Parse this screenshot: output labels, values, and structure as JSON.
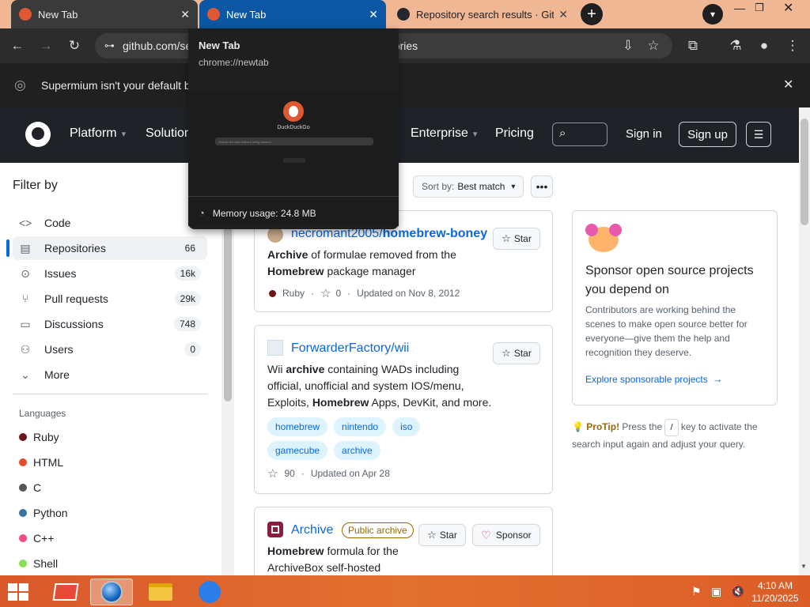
{
  "browser": {
    "tabs": [
      {
        "title": "New Tab"
      },
      {
        "title": "New Tab"
      },
      {
        "title": "Repository search results · GitHub"
      }
    ],
    "address": "github.com/search?q=homebrew+archive&type=repositories",
    "infobar_text": "Supermium isn't your default browser"
  },
  "hover_card": {
    "title": "New Tab",
    "url": "chrome://newtab",
    "preview_brand": "DuckDuckGo",
    "preview_search_placeholder": "Search the web without being tracked",
    "memory": "Memory usage: 24.8 MB"
  },
  "gh": {
    "nav": [
      "Platform",
      "Solutions",
      "Enterprise",
      "Pricing"
    ],
    "sign_in": "Sign in",
    "sign_up": "Sign up"
  },
  "sidebar": {
    "heading": "Filter by",
    "items": [
      {
        "label": "Code",
        "count": ""
      },
      {
        "label": "Repositories",
        "count": "66"
      },
      {
        "label": "Issues",
        "count": "16k"
      },
      {
        "label": "Pull requests",
        "count": "29k"
      },
      {
        "label": "Discussions",
        "count": "748"
      },
      {
        "label": "Users",
        "count": "0"
      },
      {
        "label": "More",
        "count": ""
      }
    ],
    "languages_heading": "Languages",
    "languages": [
      {
        "name": "Ruby",
        "color": "#701516"
      },
      {
        "name": "HTML",
        "color": "#e34c26"
      },
      {
        "name": "C",
        "color": "#555555"
      },
      {
        "name": "Python",
        "color": "#3572A5"
      },
      {
        "name": "C++",
        "color": "#f34b7d"
      },
      {
        "name": "Shell",
        "color": "#89e051"
      }
    ]
  },
  "results": {
    "sort_label": "Sort by:",
    "sort_value": "Best match",
    "star_label": "Star",
    "sponsor_label": "Sponsor",
    "repo1": {
      "name_owner": "necromant2005/",
      "name_repo": "homebrew-boney",
      "desc_bold": "Archive",
      "desc_rest": " of formulae removed from the",
      "desc_bold2": "Homebrew",
      "desc_rest2": " package manager",
      "language": "Ruby",
      "stars": "0",
      "updated": "Updated on Nov 8, 2012"
    },
    "repo2": {
      "name": "ForwarderFactory/wii",
      "desc_a": "Wii ",
      "desc_b": "archive",
      "desc_c": " containing WADs including",
      "desc_line2": "official, unofficial and system IOS/menu,",
      "desc_line3a": "Exploits, ",
      "desc_line3b": "Homebrew",
      "desc_line3c": " Apps, DevKit, and more.",
      "topics": [
        "homebrew",
        "nintendo",
        "iso",
        "gamecube",
        "archive"
      ],
      "stars": "90",
      "updated": "Updated on Apr 28"
    },
    "repo3": {
      "name": "Archive",
      "badge": "Public archive",
      "desc_bold": "Homebrew",
      "desc_rest": " formula for the",
      "desc_line2": "ArchiveBox self-hosted"
    }
  },
  "sponsor_panel": {
    "title": "Sponsor open source projects you depend on",
    "body": "Contributors are working behind the scenes to make open source better for everyone—give them the help and recognition they deserve.",
    "link": "Explore sponsorable projects"
  },
  "protip": {
    "label": "ProTip!",
    "text_a": "Press the",
    "key": "/",
    "text_b": "key to activate the search input again and adjust your query."
  },
  "taskbar": {
    "time": "4:10 AM",
    "date": "11/20/2025"
  }
}
